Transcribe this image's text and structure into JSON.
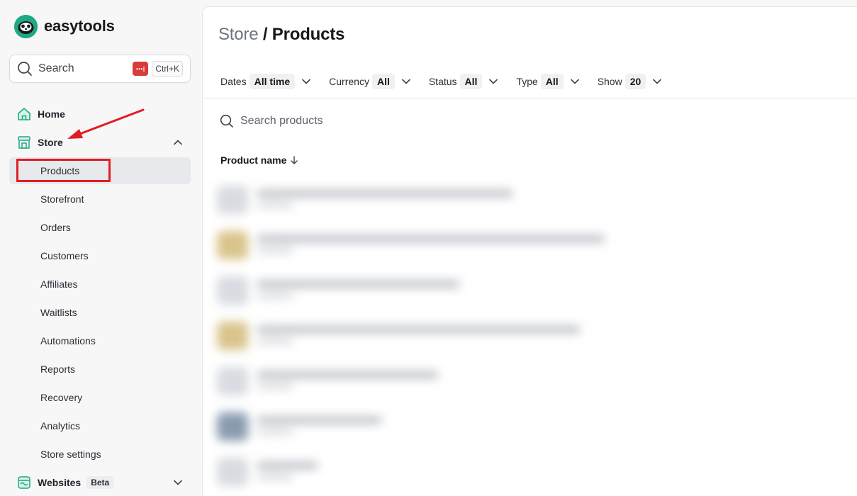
{
  "app": {
    "name": "easytools"
  },
  "search": {
    "label": "Search",
    "shortcut": "Ctrl+K",
    "password_badge": "•••|"
  },
  "nav": {
    "home": "Home",
    "store": "Store",
    "store_items": [
      "Products",
      "Storefront",
      "Orders",
      "Customers",
      "Affiliates",
      "Waitlists",
      "Automations",
      "Reports",
      "Recovery",
      "Analytics",
      "Store settings"
    ],
    "websites": "Websites",
    "websites_badge": "Beta"
  },
  "page": {
    "breadcrumb_parent": "Store",
    "breadcrumb_sep": " / ",
    "title": "Products"
  },
  "filters": [
    {
      "label": "Dates",
      "value": "All time"
    },
    {
      "label": "Currency",
      "value": "All"
    },
    {
      "label": "Status",
      "value": "All"
    },
    {
      "label": "Type",
      "value": "All"
    },
    {
      "label": "Show",
      "value": "20"
    }
  ],
  "product_search": {
    "placeholder": "Search products"
  },
  "table": {
    "column_product_name": "Product name"
  },
  "colors": {
    "brand": "#1fa982",
    "annotation_red": "#e11d24",
    "thumb_gold": "#d9c48c",
    "thumb_blue": "#8a9bb0"
  }
}
